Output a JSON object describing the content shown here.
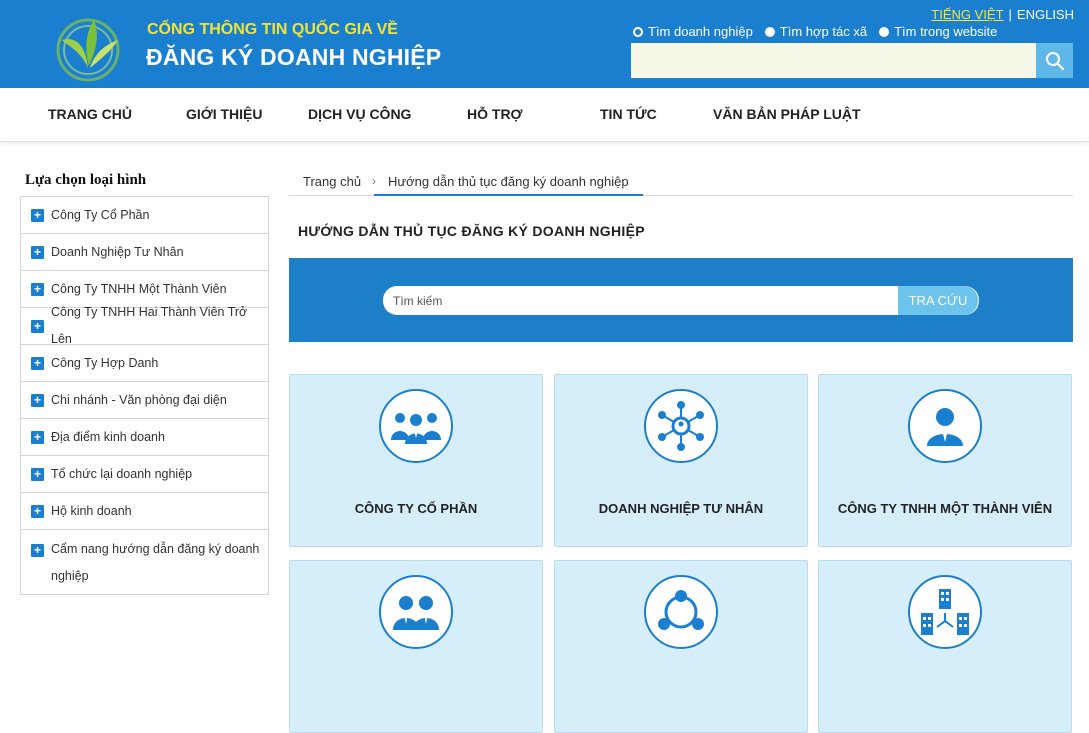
{
  "header": {
    "brand_top": "CỔNG THÔNG TIN QUỐC GIA VỀ",
    "brand_main": "ĐĂNG KÝ DOANH NGHIỆP",
    "lang_active": "TIẾNG VIỆT",
    "lang_sep": "|",
    "lang_other": "ENGLISH",
    "search_options": [
      "Tìm doanh nghiệp",
      "Tìm hợp tác xã",
      "Tìm trong website"
    ],
    "search_selected": 0,
    "search_value": "",
    "icons": {
      "logo": "leaf-logo-icon",
      "search": "search-icon"
    }
  },
  "nav": {
    "items": [
      "TRANG CHỦ",
      "GIỚI THIỆU",
      "DỊCH VỤ CÔNG",
      "HỖ TRỢ",
      "TIN TỨC",
      "VĂN BẢN PHÁP LUẬT"
    ]
  },
  "sidebar": {
    "title": "Lựa chọn loại hình",
    "items": [
      "Công Ty Cổ Phần",
      "Doanh Nghiệp Tư Nhân",
      "Công Ty TNHH Một Thành Viên",
      "Công Ty TNHH Hai Thành Viên Trở Lên",
      "Công Ty Hợp Danh",
      "Chi nhánh - Văn phòng đại diện",
      "Địa điểm kinh doanh",
      "Tổ chức lại doanh nghiệp",
      "Hộ kinh doanh",
      "Cẩm nang hướng dẫn đăng ký doanh nghiệp"
    ]
  },
  "breadcrumb": {
    "home": "Trang chủ",
    "separator": "›",
    "current": "Hướng dẫn thủ tục đăng ký doanh nghiệp"
  },
  "main": {
    "title": "HƯỚNG DẪN THỦ TỤC ĐĂNG KÝ DOANH NGHIỆP",
    "lookup": {
      "placeholder": "Tìm kiếm",
      "button": "TRA CỨU"
    },
    "cards": [
      {
        "label": "CÔNG TY CỔ PHẦN",
        "icon": "group-people-icon"
      },
      {
        "label": "DOANH NGHIỆP TƯ NHÂN",
        "icon": "network-icon"
      },
      {
        "label": "CÔNG TY TNHH MỘT THÀNH VIÊN",
        "icon": "person-icon"
      },
      {
        "label": "",
        "icon": "two-people-icon"
      },
      {
        "label": "",
        "icon": "partnership-cycle-icon"
      },
      {
        "label": "",
        "icon": "buildings-icon"
      }
    ]
  },
  "colors": {
    "header_blue": "#1b7fcf",
    "brand_yellow": "#f2e33a",
    "card_bg": "#d5eef9",
    "lookup_btn": "#6cc3ec"
  }
}
